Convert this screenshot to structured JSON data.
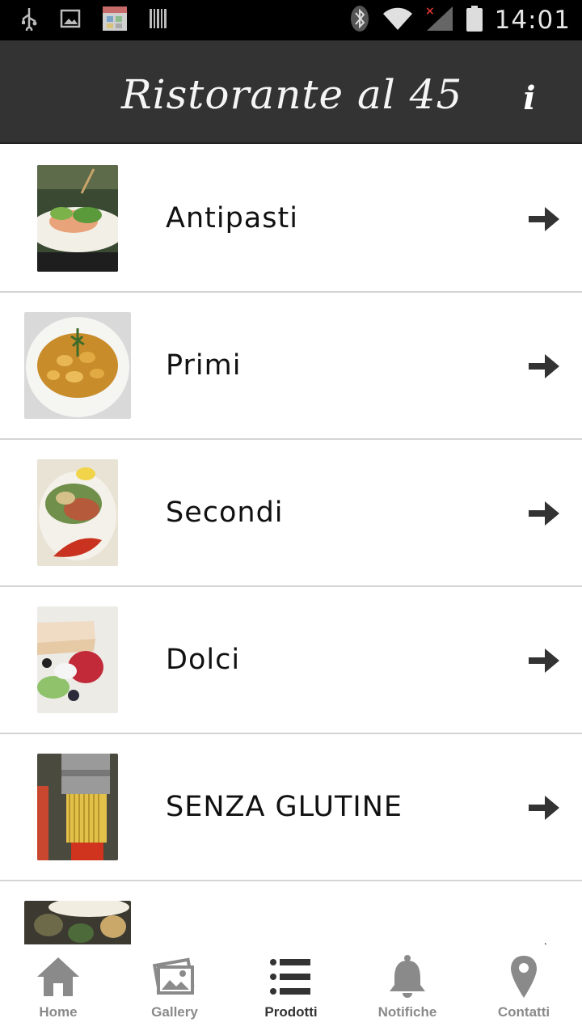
{
  "status_bar": {
    "time": "14:01",
    "left_icons": [
      "usb-icon",
      "image-icon",
      "calendar-icon",
      "barcode-icon"
    ],
    "right_icons": [
      "bluetooth-icon",
      "wifi-icon",
      "signal-icon",
      "battery-icon"
    ]
  },
  "header": {
    "title": "Ristorante al 45",
    "info_label": "i"
  },
  "menu": {
    "items": [
      {
        "label": "Antipasti"
      },
      {
        "label": "Primi"
      },
      {
        "label": "Secondi"
      },
      {
        "label": "Dolci"
      },
      {
        "label": "SENZA GLUTINE"
      },
      {
        "label": ""
      }
    ]
  },
  "bottom_nav": {
    "items": [
      {
        "label": "Home",
        "icon": "home-icon"
      },
      {
        "label": "Gallery",
        "icon": "gallery-icon"
      },
      {
        "label": "Prodotti",
        "icon": "list-icon",
        "active": true
      },
      {
        "label": "Notifiche",
        "icon": "bell-icon"
      },
      {
        "label": "Contatti",
        "icon": "map-pin-icon"
      }
    ]
  },
  "colors": {
    "header_bg": "#333333",
    "status_bg": "#000000",
    "nav_inactive": "#8a8a8a",
    "nav_active": "#333333"
  }
}
